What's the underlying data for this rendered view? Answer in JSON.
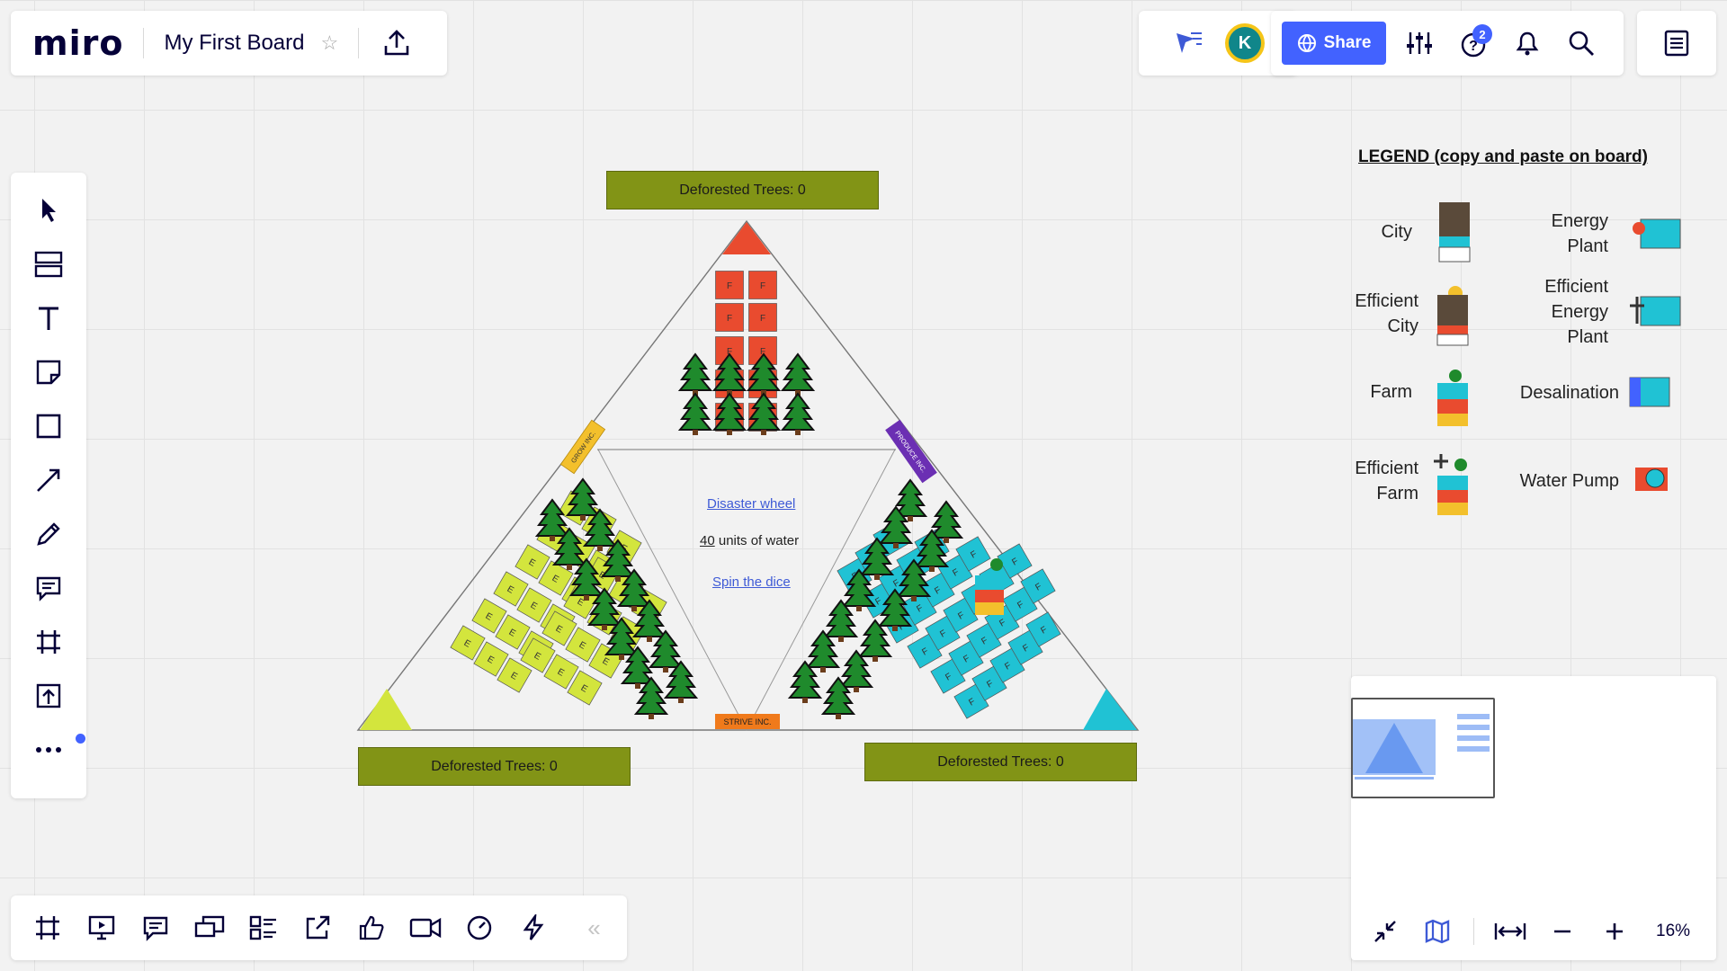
{
  "app": {
    "logo": "miro",
    "board_title": "My First Board"
  },
  "header": {
    "avatar_initial": "K",
    "share_label": "Share",
    "help_badge_count": "2"
  },
  "board": {
    "deforested_top": "Deforested Trees: 0",
    "deforested_left": "Deforested Trees: 0",
    "deforested_right": "Deforested Trees: 0",
    "center": {
      "disaster_link": "Disaster wheel",
      "water_amount": "40",
      "water_label": "units of water",
      "dice_link": "Spin the dice"
    },
    "labels": {
      "grow": "GROW INC.",
      "produce": "PRODUCE INC.",
      "strive": "STRIVE INC."
    },
    "cell_letters": {
      "red": "F",
      "green": "E",
      "cyan": "F"
    },
    "colors": {
      "red": "#e94b2f",
      "green": "#d3e53d",
      "cyan": "#20c2d4",
      "tree": "#1f8a2c",
      "purple": "#6b2fb3",
      "orange": "#f07a1b",
      "gold": "#f3c02c"
    }
  },
  "legend": {
    "title": "LEGEND (copy and paste on board)",
    "items": [
      {
        "label_line1": "City",
        "label_line2": ""
      },
      {
        "label_line1": "Energy",
        "label_line2": "Plant"
      },
      {
        "label_line1": "Efficient",
        "label_line2": "City"
      },
      {
        "label_line1": "Efficient",
        "label_line2": "Energy",
        "label_line3": "Plant"
      },
      {
        "label_line1": "Farm",
        "label_line2": ""
      },
      {
        "label_line1": "Desalination",
        "label_line2": ""
      },
      {
        "label_line1": "Efficient",
        "label_line2": "Farm"
      },
      {
        "label_line1": "Water Pump",
        "label_line2": ""
      }
    ]
  },
  "minimap": {
    "zoom": "16%"
  }
}
